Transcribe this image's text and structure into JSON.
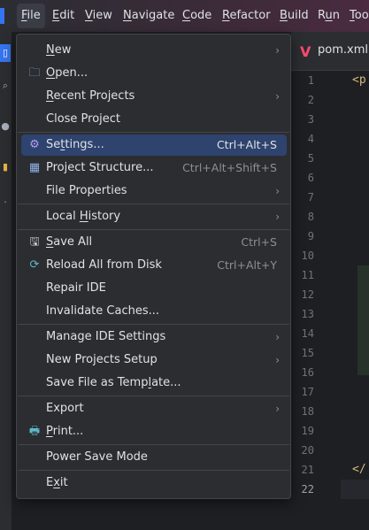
{
  "menubar": {
    "items": [
      {
        "label": "File",
        "mnemonic": "F"
      },
      {
        "label": "Edit",
        "mnemonic": "E"
      },
      {
        "label": "View",
        "mnemonic": "V"
      },
      {
        "label": "Navigate",
        "mnemonic": "N"
      },
      {
        "label": "Code",
        "mnemonic": "C"
      },
      {
        "label": "Refactor",
        "mnemonic": "R"
      },
      {
        "label": "Build",
        "mnemonic": "B"
      },
      {
        "label": "Run",
        "mnemonic": "u"
      },
      {
        "label": "Too",
        "mnemonic": "T"
      }
    ]
  },
  "editor": {
    "tab_label": "pom.xml",
    "tab_icon_glyph": "V",
    "line_numbers": [
      "1",
      "2",
      "3",
      "4",
      "5",
      "6",
      "7",
      "8",
      "9",
      "10",
      "11",
      "12",
      "13",
      "14",
      "15",
      "16",
      "17",
      "18",
      "19",
      "20",
      "21",
      "22"
    ],
    "line1_code": "<p",
    "line21_code": "</"
  },
  "file_menu": {
    "items": [
      {
        "id": "new",
        "pre": "",
        "mn": "N",
        "post": "ew",
        "shortcut": "",
        "submenu": true,
        "icon": ""
      },
      {
        "id": "open",
        "pre": "",
        "mn": "O",
        "post": "pen...",
        "shortcut": "",
        "submenu": false,
        "icon": "folder-icon"
      },
      {
        "id": "recent-projects",
        "pre": "",
        "mn": "R",
        "post": "ecent Projects",
        "shortcut": "",
        "submenu": true,
        "icon": ""
      },
      {
        "id": "close-project",
        "pre": "Close Pro",
        "mn": "",
        "post": "ject",
        "shortcut": "",
        "submenu": false,
        "icon": ""
      },
      {
        "id": "settings",
        "pre": "Se",
        "mn": "t",
        "post": "tings...",
        "shortcut": "Ctrl+Alt+S",
        "submenu": false,
        "icon": "gear-icon",
        "selected": true
      },
      {
        "id": "project-structure",
        "pre": "Project Structure...",
        "mn": "",
        "post": "",
        "shortcut": "Ctrl+Alt+Shift+S",
        "submenu": false,
        "icon": "grid-icon"
      },
      {
        "id": "file-properties",
        "pre": "File Properties",
        "mn": "",
        "post": "",
        "shortcut": "",
        "submenu": true,
        "icon": ""
      },
      {
        "id": "local-history",
        "pre": "Local ",
        "mn": "H",
        "post": "istory",
        "shortcut": "",
        "submenu": true,
        "icon": ""
      },
      {
        "id": "save-all",
        "pre": "",
        "mn": "S",
        "post": "ave All",
        "shortcut": "Ctrl+S",
        "submenu": false,
        "icon": "save-icon"
      },
      {
        "id": "reload-all",
        "pre": "Reload All from Disk",
        "mn": "",
        "post": "",
        "shortcut": "Ctrl+Alt+Y",
        "submenu": false,
        "icon": "reload-icon"
      },
      {
        "id": "repair-ide",
        "pre": "Repair IDE",
        "mn": "",
        "post": "",
        "shortcut": "",
        "submenu": false,
        "icon": ""
      },
      {
        "id": "invalidate-caches",
        "pre": "Invalidate Caches...",
        "mn": "",
        "post": "",
        "shortcut": "",
        "submenu": false,
        "icon": ""
      },
      {
        "id": "manage-ide-settings",
        "pre": "Manage IDE Settings",
        "mn": "",
        "post": "",
        "shortcut": "",
        "submenu": true,
        "icon": ""
      },
      {
        "id": "new-projects-setup",
        "pre": "New Projects Setup",
        "mn": "",
        "post": "",
        "shortcut": "",
        "submenu": true,
        "icon": ""
      },
      {
        "id": "save-file-as-template",
        "pre": "Save File as Temp",
        "mn": "l",
        "post": "ate...",
        "shortcut": "",
        "submenu": false,
        "icon": ""
      },
      {
        "id": "export",
        "pre": "Export",
        "mn": "",
        "post": "",
        "shortcut": "",
        "submenu": true,
        "icon": ""
      },
      {
        "id": "print",
        "pre": "",
        "mn": "P",
        "post": "rint...",
        "shortcut": "",
        "submenu": false,
        "icon": "printer-icon"
      },
      {
        "id": "power-save-mode",
        "pre": "Power Save Mode",
        "mn": "",
        "post": "",
        "shortcut": "",
        "submenu": false,
        "icon": ""
      },
      {
        "id": "exit",
        "pre": "E",
        "mn": "x",
        "post": "it",
        "shortcut": "",
        "submenu": false,
        "icon": ""
      }
    ]
  },
  "colors": {
    "accent": "#3574f0",
    "selection": "#2e436e",
    "menu_bg": "#2b2d30"
  }
}
